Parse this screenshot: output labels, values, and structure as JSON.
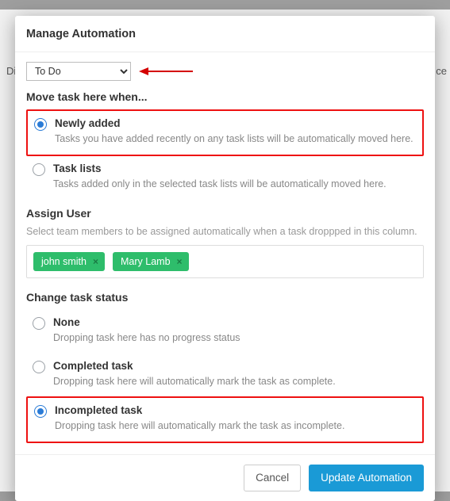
{
  "bg": {
    "left_text": "Di",
    "right_text": "ce",
    "card_placeholder_left": "",
    "card_placeholder_right": ""
  },
  "modal": {
    "title": "Manage Automation",
    "dropdown": {
      "selected": "To Do"
    },
    "move_section": {
      "heading": "Move task here when...",
      "options": [
        {
          "label": "Newly added",
          "desc": "Tasks you have added recently on any task lists will be automatically moved here.",
          "selected": true,
          "highlighted": true
        },
        {
          "label": "Task lists",
          "desc": "Tasks added only in the selected task lists will be automatically moved here.",
          "selected": false,
          "highlighted": false
        }
      ]
    },
    "assign_section": {
      "heading": "Assign User",
      "desc": "Select team members to be assigned automatically when a task droppped in this column.",
      "tags": [
        "john smith",
        "Mary Lamb"
      ]
    },
    "status_section": {
      "heading": "Change task status",
      "options": [
        {
          "label": "None",
          "desc": "Dropping task here has no progress status",
          "selected": false,
          "highlighted": false
        },
        {
          "label": "Completed task",
          "desc": "Dropping task here will automatically mark the task as complete.",
          "selected": false,
          "highlighted": false
        },
        {
          "label": "Incompleted task",
          "desc": "Dropping task here will automatically mark the task as incomplete.",
          "selected": true,
          "highlighted": true
        }
      ]
    },
    "footer": {
      "cancel": "Cancel",
      "update": "Update Automation"
    }
  }
}
